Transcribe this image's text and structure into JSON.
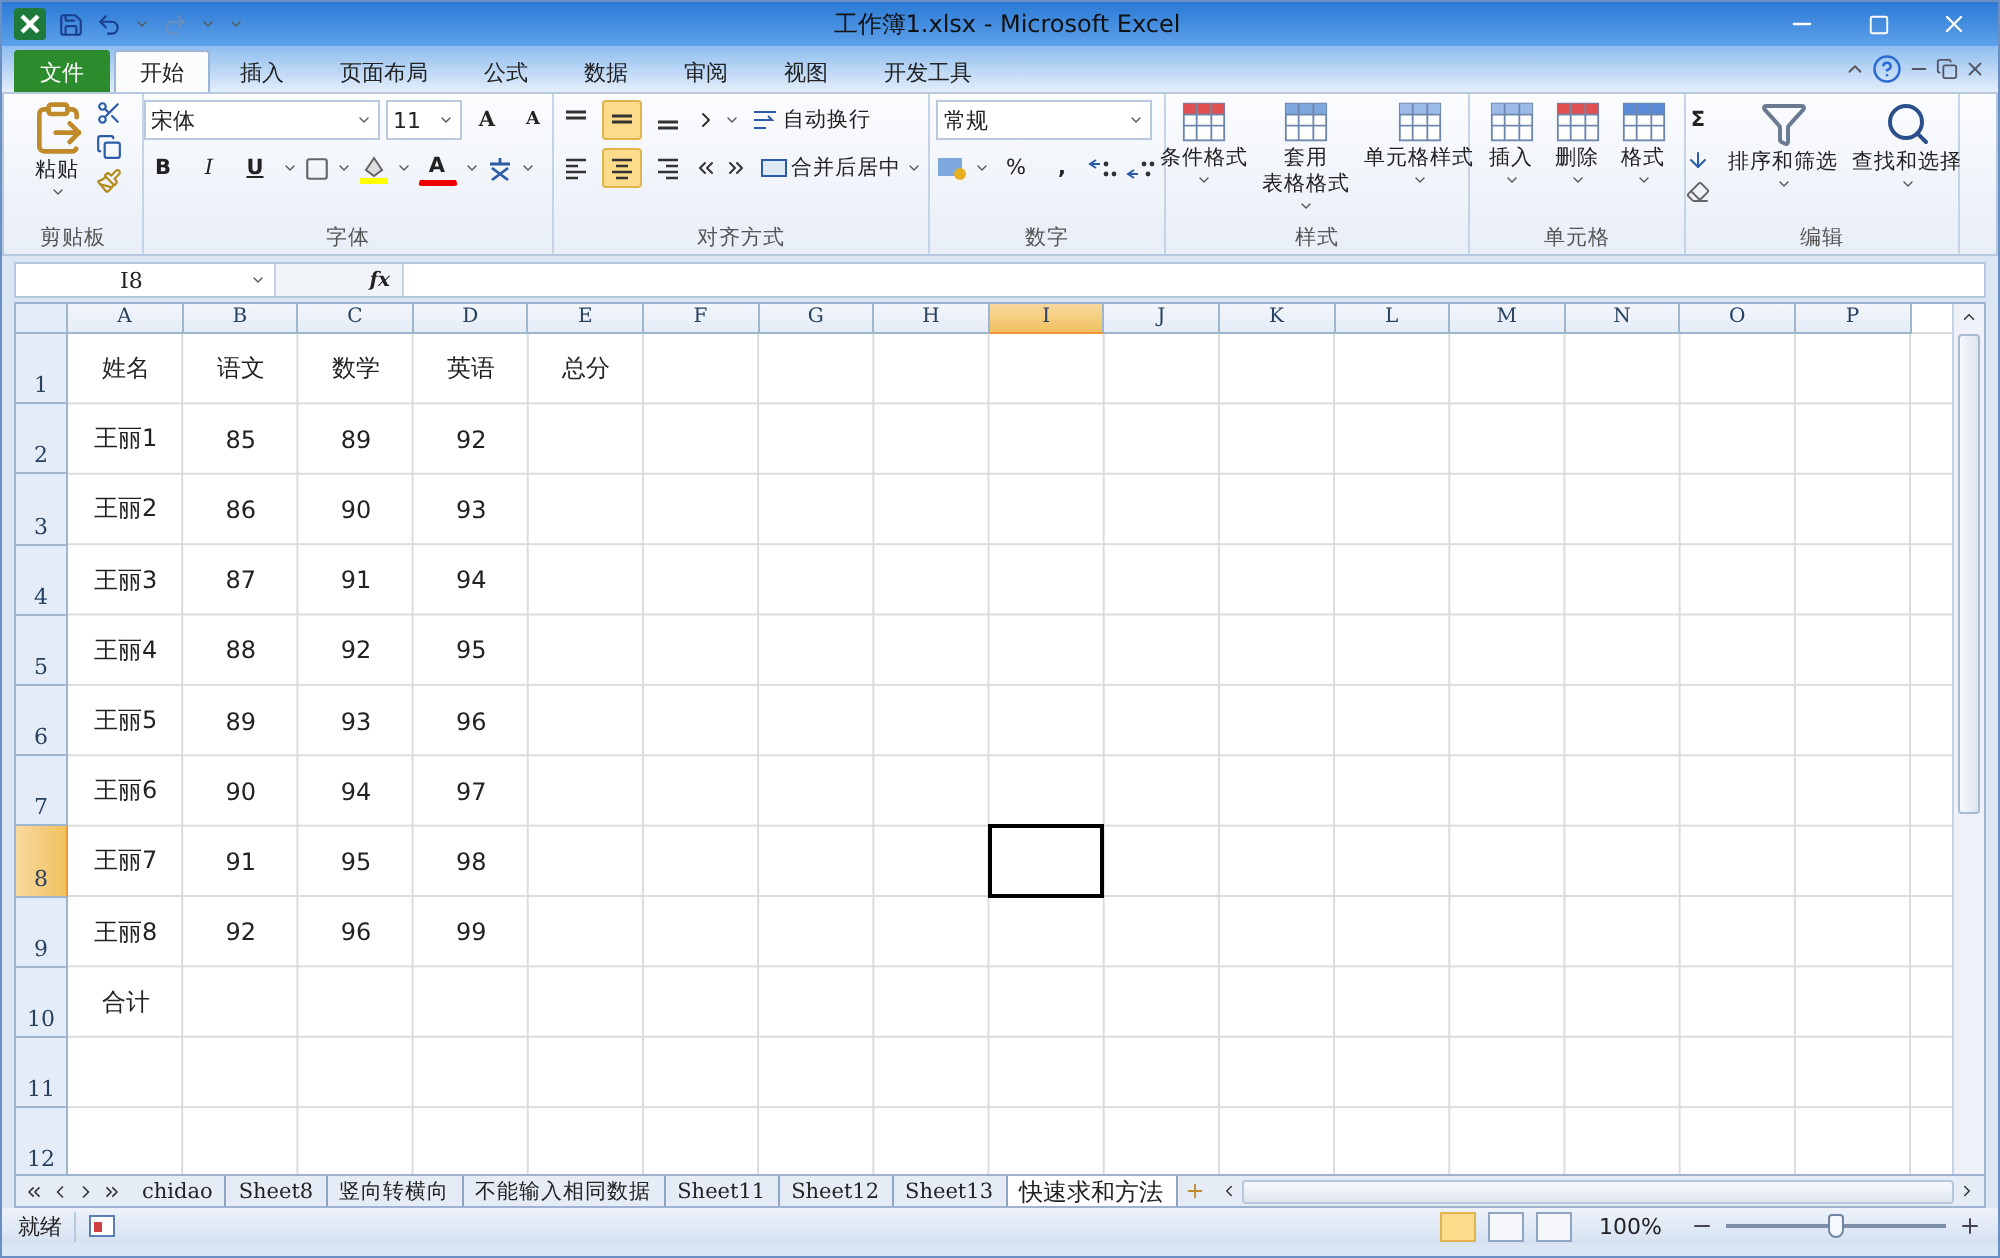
{
  "window": {
    "title": "工作簿1.xlsx - Microsoft Excel"
  },
  "ribbon_tabs": [
    {
      "label": "文件",
      "kind": "file",
      "selected": false
    },
    {
      "label": "开始",
      "kind": "tab",
      "selected": true
    },
    {
      "label": "插入",
      "kind": "tab",
      "selected": false
    },
    {
      "label": "页面布局",
      "kind": "tab",
      "selected": false
    },
    {
      "label": "公式",
      "kind": "tab",
      "selected": false
    },
    {
      "label": "数据",
      "kind": "tab",
      "selected": false
    },
    {
      "label": "审阅",
      "kind": "tab",
      "selected": false
    },
    {
      "label": "视图",
      "kind": "tab",
      "selected": false
    },
    {
      "label": "开发工具",
      "kind": "tab",
      "selected": false
    }
  ],
  "ribbon": {
    "clipboard": {
      "label": "剪贴板",
      "paste": "粘贴"
    },
    "font": {
      "label": "字体",
      "font_name": "宋体",
      "font_size": "11",
      "grow": "A",
      "shrink": "A",
      "bold": "B",
      "italic": "I",
      "underline": "U",
      "font_color": "A"
    },
    "alignment": {
      "label": "对齐方式",
      "vertical": [
        {
          "selected": false
        },
        {
          "selected": true
        },
        {
          "selected": false
        }
      ],
      "horizontal": [
        {
          "selected": false
        },
        {
          "selected": true
        },
        {
          "selected": false
        }
      ],
      "wrap": "自动换行",
      "merge": "合并后居中"
    },
    "number": {
      "label": "数字",
      "format": "常规",
      "percent": "%",
      "comma": ","
    },
    "styles": {
      "label": "样式",
      "buttons": [
        {
          "lines": [
            "条件格式"
          ]
        },
        {
          "lines": [
            "套用",
            "表格格式"
          ]
        },
        {
          "lines": [
            "单元格样式"
          ]
        }
      ]
    },
    "cells": {
      "label": "单元格",
      "buttons": [
        "插入",
        "删除",
        "格式"
      ]
    },
    "editing": {
      "label": "编辑",
      "sum": "Σ",
      "buttons": [
        "排序和筛选",
        "查找和选择"
      ]
    }
  },
  "formula_bar": {
    "name_box": "I8",
    "fx": "fx"
  },
  "columns": [
    {
      "label": "A",
      "selected": false
    },
    {
      "label": "B",
      "selected": false
    },
    {
      "label": "C",
      "selected": false
    },
    {
      "label": "D",
      "selected": false
    },
    {
      "label": "E",
      "selected": false
    },
    {
      "label": "F",
      "selected": false
    },
    {
      "label": "G",
      "selected": false
    },
    {
      "label": "H",
      "selected": false
    },
    {
      "label": "I",
      "selected": true
    },
    {
      "label": "J",
      "selected": false
    },
    {
      "label": "K",
      "selected": false
    },
    {
      "label": "L",
      "selected": false
    },
    {
      "label": "M",
      "selected": false
    },
    {
      "label": "N",
      "selected": false
    },
    {
      "label": "O",
      "selected": false
    },
    {
      "label": "P",
      "selected": false
    }
  ],
  "rows": [
    {
      "header": "1",
      "selected": false,
      "cells": [
        "姓名",
        "语文",
        "数学",
        "英语",
        "总分"
      ]
    },
    {
      "header": "2",
      "selected": false,
      "cells": [
        "王丽1",
        "85",
        "89",
        "92"
      ]
    },
    {
      "header": "3",
      "selected": false,
      "cells": [
        "王丽2",
        "86",
        "90",
        "93"
      ]
    },
    {
      "header": "4",
      "selected": false,
      "cells": [
        "王丽3",
        "87",
        "91",
        "94"
      ]
    },
    {
      "header": "5",
      "selected": false,
      "cells": [
        "王丽4",
        "88",
        "92",
        "95"
      ]
    },
    {
      "header": "6",
      "selected": false,
      "cells": [
        "王丽5",
        "89",
        "93",
        "96"
      ]
    },
    {
      "header": "7",
      "selected": false,
      "cells": [
        "王丽6",
        "90",
        "94",
        "97"
      ]
    },
    {
      "header": "8",
      "selected": true,
      "cells": [
        "王丽7",
        "91",
        "95",
        "98"
      ]
    },
    {
      "header": "9",
      "selected": false,
      "cells": [
        "王丽8",
        "92",
        "96",
        "99"
      ]
    },
    {
      "header": "10",
      "selected": false,
      "cells": [
        "合计"
      ]
    },
    {
      "header": "11",
      "selected": false,
      "cells": []
    },
    {
      "header": "12",
      "selected": false,
      "cells": []
    }
  ],
  "sheet_tabs": [
    {
      "label": "chidao",
      "selected": false
    },
    {
      "label": "Sheet8",
      "selected": false
    },
    {
      "label": "竖向转横向",
      "selected": false
    },
    {
      "label": "不能输入相同数据",
      "selected": false
    },
    {
      "label": "Sheet11",
      "selected": false
    },
    {
      "label": "Sheet12",
      "selected": false
    },
    {
      "label": "Sheet13",
      "selected": false
    },
    {
      "label": "快速求和方法",
      "selected": true
    }
  ],
  "status_bar": {
    "status": "就绪",
    "views": [
      {
        "selected": true
      },
      {
        "selected": false
      },
      {
        "selected": false
      }
    ],
    "zoom": "100%",
    "zoom_level": {
      "level": 0.5
    }
  }
}
